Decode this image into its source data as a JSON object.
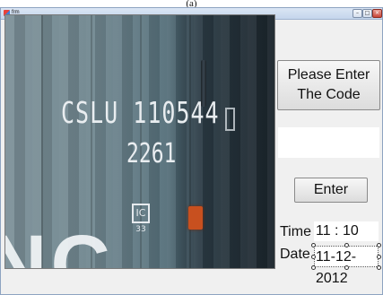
{
  "caption": "(a)",
  "window": {
    "title": "frm"
  },
  "photo": {
    "container_prefix": "CSLU",
    "container_number": "110544",
    "check_digit": "1",
    "type_code": "2261",
    "gauge_mark": "IC",
    "gauge_sub": "33",
    "big_letters": "NC"
  },
  "form": {
    "prompt_button": "Please Enter The Code",
    "code_input_value": "",
    "enter_button": "Enter",
    "time_label": "Time :",
    "time_value": "11 : 10",
    "date_label": "Date :",
    "date_value": "11-12-2012"
  }
}
